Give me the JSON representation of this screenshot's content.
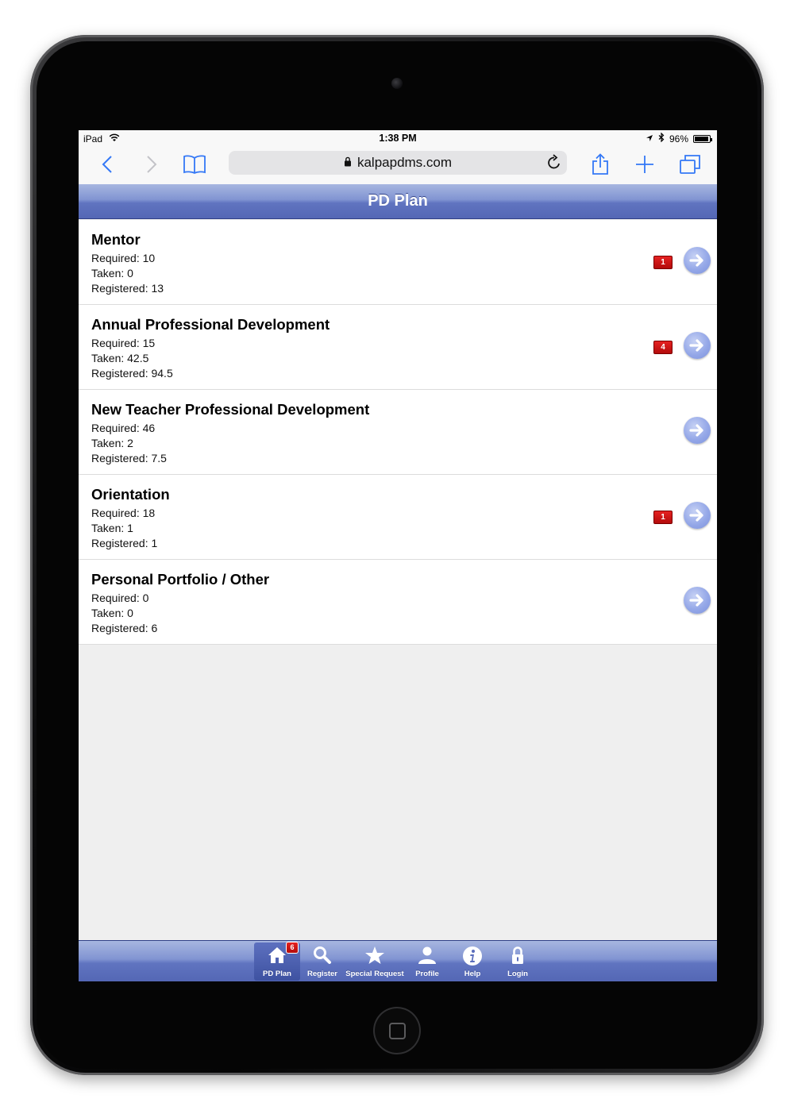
{
  "status_bar": {
    "device": "iPad",
    "time": "1:38 PM",
    "battery": "96%",
    "battery_level": 0.96
  },
  "browser": {
    "url": "kalpapdms.com",
    "icons": {
      "back": "chevron-left-icon",
      "forward": "chevron-right-icon",
      "bookmarks": "book-icon",
      "lock": "lock-icon",
      "reload": "reload-icon",
      "share": "share-icon",
      "new_tab": "plus-icon",
      "tabs": "tabs-icon"
    }
  },
  "header": {
    "title": "PD Plan"
  },
  "plans": [
    {
      "title": "Mentor",
      "required": "Required: 10",
      "taken": "Taken: 0",
      "registered": "Registered: 13",
      "badge": "1"
    },
    {
      "title": "Annual Professional Development",
      "required": "Required: 15",
      "taken": "Taken: 42.5",
      "registered": "Registered: 94.5",
      "badge": "4"
    },
    {
      "title": "New Teacher Professional Development",
      "required": "Required: 46",
      "taken": "Taken: 2",
      "registered": "Registered: 7.5",
      "badge": null
    },
    {
      "title": "Orientation",
      "required": "Required: 18",
      "taken": "Taken: 1",
      "registered": "Registered: 1",
      "badge": "1"
    },
    {
      "title": "Personal Portfolio / Other",
      "required": "Required: 0",
      "taken": "Taken: 0",
      "registered": "Registered: 6",
      "badge": null
    }
  ],
  "tab_bar": {
    "tabs": [
      {
        "label": "PD Plan",
        "icon": "home-icon",
        "badge": "6",
        "active": true
      },
      {
        "label": "Register",
        "icon": "search-icon",
        "active": false
      },
      {
        "label": "Special Request",
        "icon": "star-icon",
        "active": false
      },
      {
        "label": "Profile",
        "icon": "person-icon",
        "active": false
      },
      {
        "label": "Help",
        "icon": "info-icon",
        "active": false
      },
      {
        "label": "Login",
        "icon": "lock-icon",
        "active": false
      }
    ]
  },
  "colors": {
    "header_blue": "#6074c0",
    "badge_red": "#c01010",
    "arrow_blue": "#95a8e8",
    "link_blue": "#3478f6"
  }
}
